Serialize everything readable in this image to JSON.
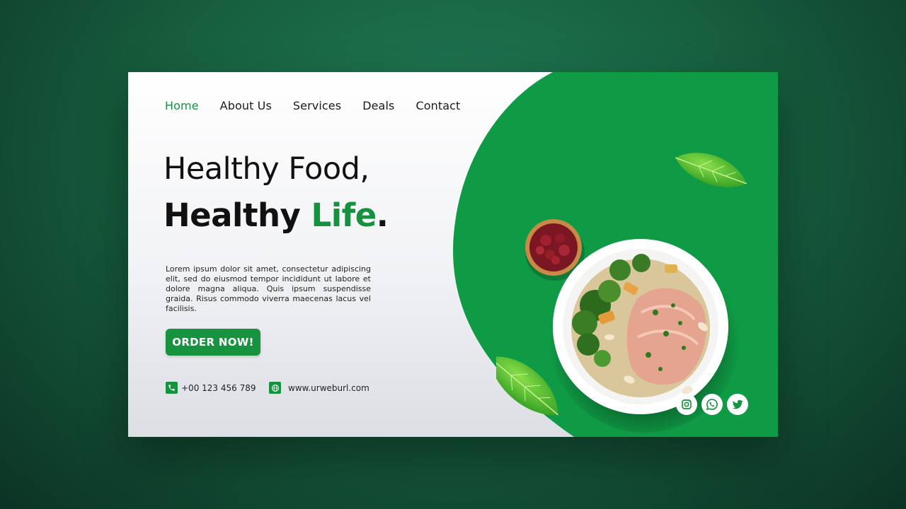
{
  "nav": {
    "items": [
      {
        "label": "Home",
        "active": true
      },
      {
        "label": "About Us",
        "active": false
      },
      {
        "label": "Services",
        "active": false
      },
      {
        "label": "Deals",
        "active": false
      },
      {
        "label": "Contact",
        "active": false
      }
    ]
  },
  "hero": {
    "title_line1": "Healthy Food,",
    "title_line2_prefix": "Healthy ",
    "title_line2_accent": "Life",
    "title_line2_suffix": ".",
    "description": "Lorem ipsum dolor sit amet, consectetur adipiscing elit, sed do eiusmod tempor incididunt ut labore et dolore magna aliqua. Quis ipsum suspendisse graida. Risus commodo viverra maecenas lacus vel facilisis.",
    "cta_label": "ORDER NOW!"
  },
  "contact": {
    "phone": "+00 123 456 789",
    "website": "www.urweburl.com"
  },
  "social": [
    "instagram-icon",
    "whatsapp-icon",
    "twitter-icon"
  ],
  "colors": {
    "brand_green": "#17923f",
    "panel_green": "#0f9a45",
    "background": "#17603f"
  }
}
